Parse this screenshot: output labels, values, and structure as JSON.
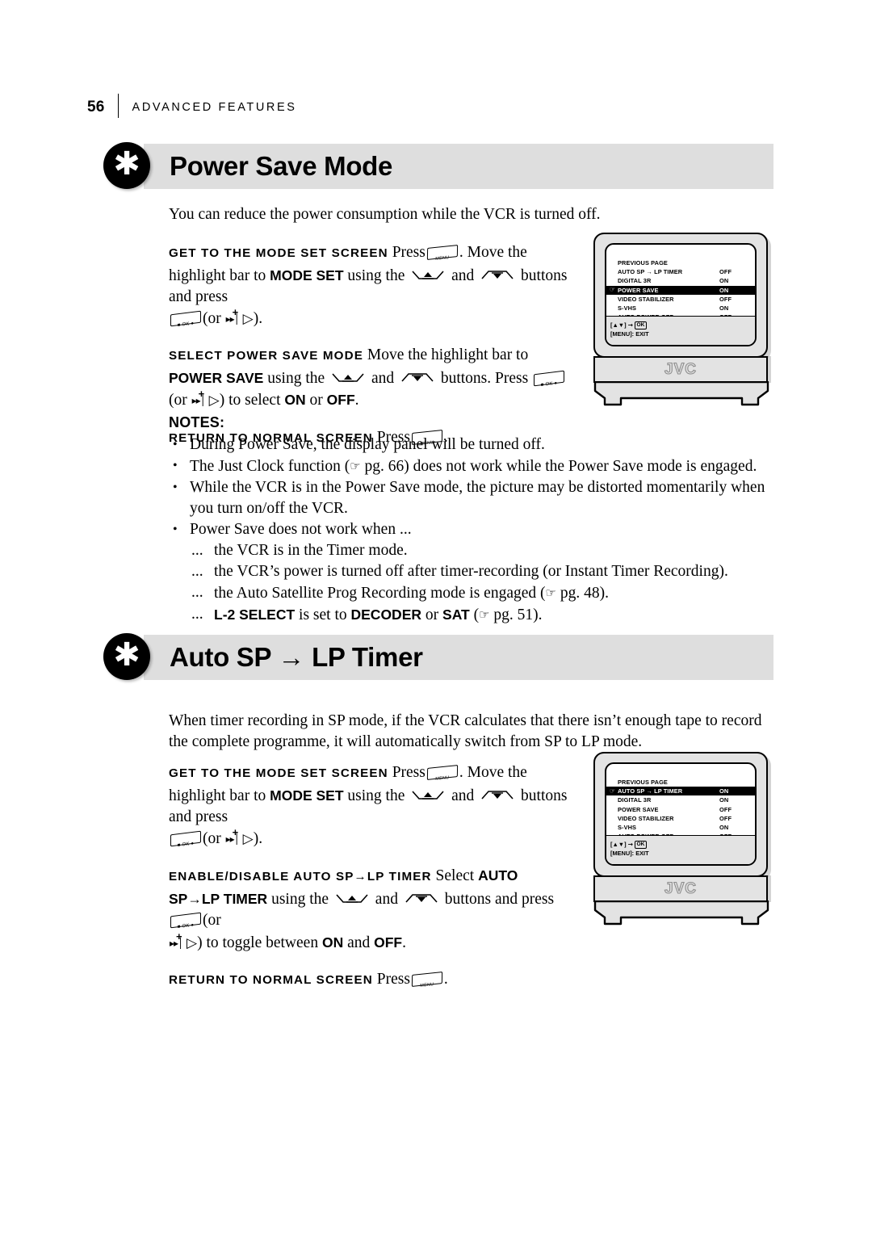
{
  "running_head": {
    "page_number": "56",
    "section": "ADVANCED FEATURES"
  },
  "sections": [
    {
      "badge_icon": "asterisk-icon",
      "title": "Power Save Mode",
      "intro": "You can reduce the power consumption while the VCR is turned off.",
      "steps": [
        {
          "label": "GET TO THE MODE SET SCREEN",
          "text_1": "Press",
          "text_2": ". Move the highlight bar to",
          "bold_1": "MODE SET",
          "text_3": "using the",
          "text_4": "and",
          "text_5": "buttons and press",
          "text_6": "(or",
          "text_7": ")."
        },
        {
          "label": "SELECT POWER SAVE MODE",
          "text_1": "Move the highlight bar to",
          "bold_1": "POWER SAVE",
          "text_2": "using the",
          "text_3": "and",
          "text_4": "buttons. Press",
          "text_5": "(or",
          "text_6": ") to select",
          "bold_2": "ON",
          "text_7": "or",
          "bold_3": "OFF",
          "text_8": "."
        },
        {
          "label": "RETURN TO NORMAL SCREEN",
          "text_1": "Press",
          "text_2": "."
        }
      ],
      "notes": {
        "title": "NOTES:",
        "items": [
          {
            "bullet": "•",
            "text": "During Power Save, the display panel will be turned off."
          },
          {
            "bullet": "•",
            "text_a": "The Just Clock function (",
            "ref": "pg. 66",
            "text_b": ") does not work while the Power Save mode is engaged."
          },
          {
            "bullet": "•",
            "text": "While the VCR is in the Power Save mode, the picture may be distorted momentarily when you turn on/off the VCR."
          },
          {
            "bullet": "•",
            "text": "Power Save does not work when ..."
          }
        ],
        "sub_items": [
          {
            "dots": "...",
            "text": "the VCR is in the Timer mode."
          },
          {
            "dots": "...",
            "text": "the VCR’s power is turned off after timer-recording (or Instant Timer Recording)."
          },
          {
            "dots": "...",
            "text_a": "the Auto Satellite Prog Recording mode is engaged (",
            "ref": "pg. 48",
            "text_b": ")."
          },
          {
            "dots": "...",
            "bold_1": "L-2 SELECT",
            "text_a": "is set to",
            "bold_2": "DECODER",
            "text_b": "or",
            "bold_3": "SAT",
            "text_c": "(",
            "ref": "pg. 51",
            "text_d": ")."
          }
        ]
      },
      "tv": {
        "menu_rows": [
          {
            "cursor": "",
            "name": "PREVIOUS PAGE",
            "value": "",
            "highlighted": false
          },
          {
            "cursor": "",
            "name": "AUTO SP → LP TIMER",
            "value": "OFF",
            "highlighted": false
          },
          {
            "cursor": "",
            "name": "DIGITAL 3R",
            "value": "ON",
            "highlighted": false
          },
          {
            "cursor": "☞",
            "name": "POWER SAVE",
            "value": "ON",
            "highlighted": true
          },
          {
            "cursor": "",
            "name": "VIDEO STABILIZER",
            "value": "OFF",
            "highlighted": false
          },
          {
            "cursor": "",
            "name": "S-VHS",
            "value": "ON",
            "highlighted": false
          },
          {
            "cursor": "",
            "name": "AUTO POWER OFF",
            "value": "OFF",
            "highlighted": false
          }
        ],
        "footer_line_1_prefix": "[▲▼]",
        "footer_line_1_arrow": "→",
        "footer_line_1_key": "OK",
        "footer_line_2": "[MENU]: EXIT",
        "brand": "JVC"
      }
    },
    {
      "badge_icon": "asterisk-icon",
      "title": "Auto SP → LP Timer",
      "intro": "When timer recording in SP mode, if the VCR calculates that there isn’t enough tape to record the complete programme, it will automatically switch from SP to LP mode.",
      "intro_bold_terms": [
        "SP",
        "SP",
        "LP"
      ],
      "steps": [
        {
          "label": "GET TO THE MODE SET SCREEN",
          "text_1": "Press",
          "text_2": ". Move the highlight bar to",
          "bold_1": "MODE SET",
          "text_3": "using the",
          "text_4": "and",
          "text_5": "buttons and press",
          "text_6": "(or",
          "text_7": ")."
        },
        {
          "label": "ENABLE/DISABLE AUTO SP→LP TIMER",
          "text_1": "Select",
          "bold_1": "AUTO SP→LP TIMER",
          "text_2": "using the",
          "text_3": "and",
          "text_4": "buttons and press",
          "text_5": "(or",
          "text_6": ") to toggle between",
          "bold_2": "ON",
          "text_7": "and",
          "bold_3": "OFF",
          "text_8": "."
        },
        {
          "label": "RETURN TO NORMAL SCREEN",
          "text_1": "Press",
          "text_2": "."
        }
      ],
      "tv": {
        "menu_rows": [
          {
            "cursor": "",
            "name": "PREVIOUS PAGE",
            "value": "",
            "highlighted": false
          },
          {
            "cursor": "☞",
            "name": "AUTO SP → LP TIMER",
            "value": "ON",
            "highlighted": true
          },
          {
            "cursor": "",
            "name": "DIGITAL 3R",
            "value": "ON",
            "highlighted": false
          },
          {
            "cursor": "",
            "name": "POWER SAVE",
            "value": "OFF",
            "highlighted": false
          },
          {
            "cursor": "",
            "name": "VIDEO STABILIZER",
            "value": "OFF",
            "highlighted": false
          },
          {
            "cursor": "",
            "name": "S-VHS",
            "value": "ON",
            "highlighted": false
          },
          {
            "cursor": "",
            "name": "AUTO POWER OFF",
            "value": "OFF",
            "highlighted": false
          }
        ],
        "footer_line_1_prefix": "[▲▼]",
        "footer_line_1_arrow": "→",
        "footer_line_1_key": "OK",
        "footer_line_2": "[MENU]: EXIT",
        "brand": "JVC"
      }
    }
  ],
  "colors": {
    "band": "#dedede",
    "badge": "#000000",
    "tv_body": "#e3e3e3",
    "highlight": "#000000"
  }
}
